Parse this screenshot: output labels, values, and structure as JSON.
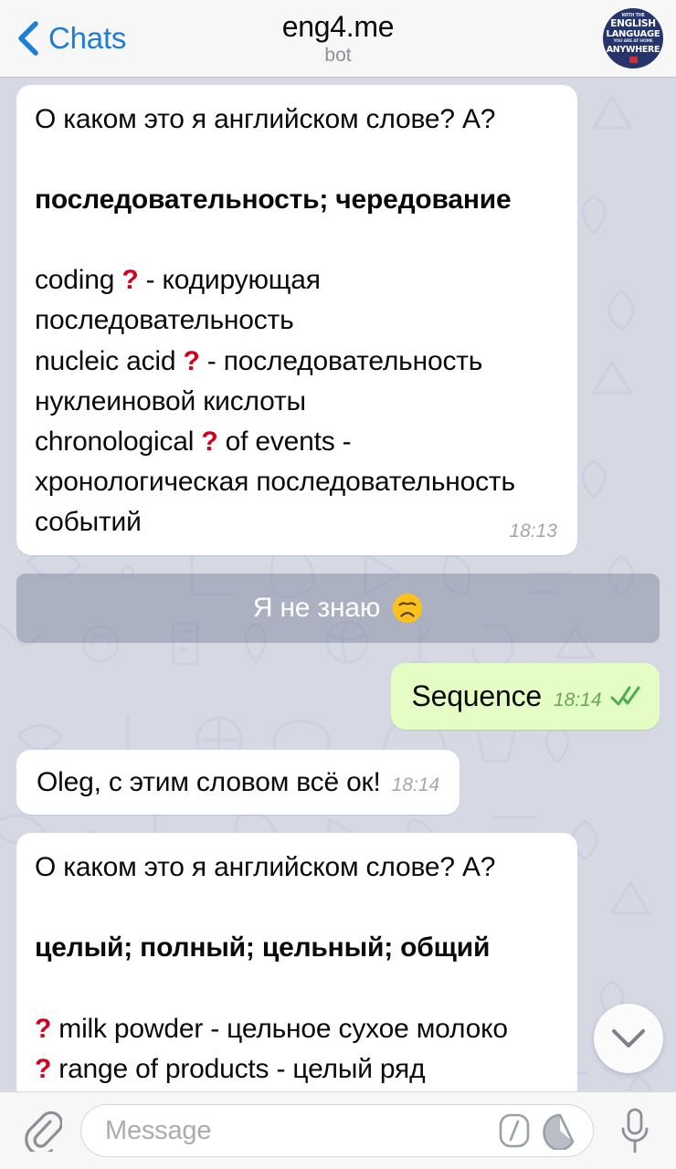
{
  "header": {
    "back_label": "Chats",
    "title": "eng4.me",
    "subtitle": "bot",
    "avatar": {
      "line_top": "WITH THE",
      "line1": "ENGLISH",
      "line2": "LANGUAGE",
      "line3": "YOU ARE AT HOME",
      "line4": "ANYWHERE"
    }
  },
  "messages": [
    {
      "id": "msg-quiz-sequence",
      "direction": "in",
      "time": "18:13",
      "prompt": "О каком это я английском слове? А?",
      "answer_bold": "последовательность; чередование",
      "examples": [
        {
          "pre": "coding ",
          "mark": "?",
          "post": " - кодирующая последовательность"
        },
        {
          "pre": "nucleic acid ",
          "mark": "?",
          "post": " - последовательность нуклеиновой кислоты"
        },
        {
          "pre": "chronological ",
          "mark": "?",
          "post": " of events - хронологическая последовательность событий"
        }
      ]
    },
    {
      "id": "kbd-dont-know",
      "type": "keyboard-button",
      "label": "Я не знаю",
      "emoji": "disappointed-face"
    },
    {
      "id": "msg-answer",
      "direction": "out",
      "text": "Sequence",
      "time": "18:14",
      "status": "read"
    },
    {
      "id": "msg-confirm",
      "direction": "in",
      "text": "Oleg, с этим словом всё ок!",
      "time": "18:14"
    },
    {
      "id": "msg-quiz-whole",
      "direction": "in",
      "clipped": true,
      "prompt": "О каком это я английском слове? А?",
      "answer_bold": "целый; полный; цельный; общий",
      "examples": [
        {
          "pre": "",
          "mark": "?",
          "post": " milk powder - цельное сухое молоко"
        },
        {
          "pre": "",
          "mark": "?",
          "post": " range of products - целый ряд"
        }
      ]
    }
  ],
  "fab": {
    "icon": "chevron-down-icon"
  },
  "input_bar": {
    "placeholder": "Message",
    "attach_icon": "paperclip-icon",
    "command_icon": "slash-command-icon",
    "sticker_icon": "sticker-icon",
    "mic_icon": "microphone-icon"
  },
  "colors": {
    "accent": "#1c7ed6",
    "outgoing_bubble": "#e3fdc4",
    "incoming_bubble": "#ffffff",
    "chat_background": "#d6d9e3",
    "question_mark": "#d0021b",
    "check_green": "#4caf50"
  }
}
